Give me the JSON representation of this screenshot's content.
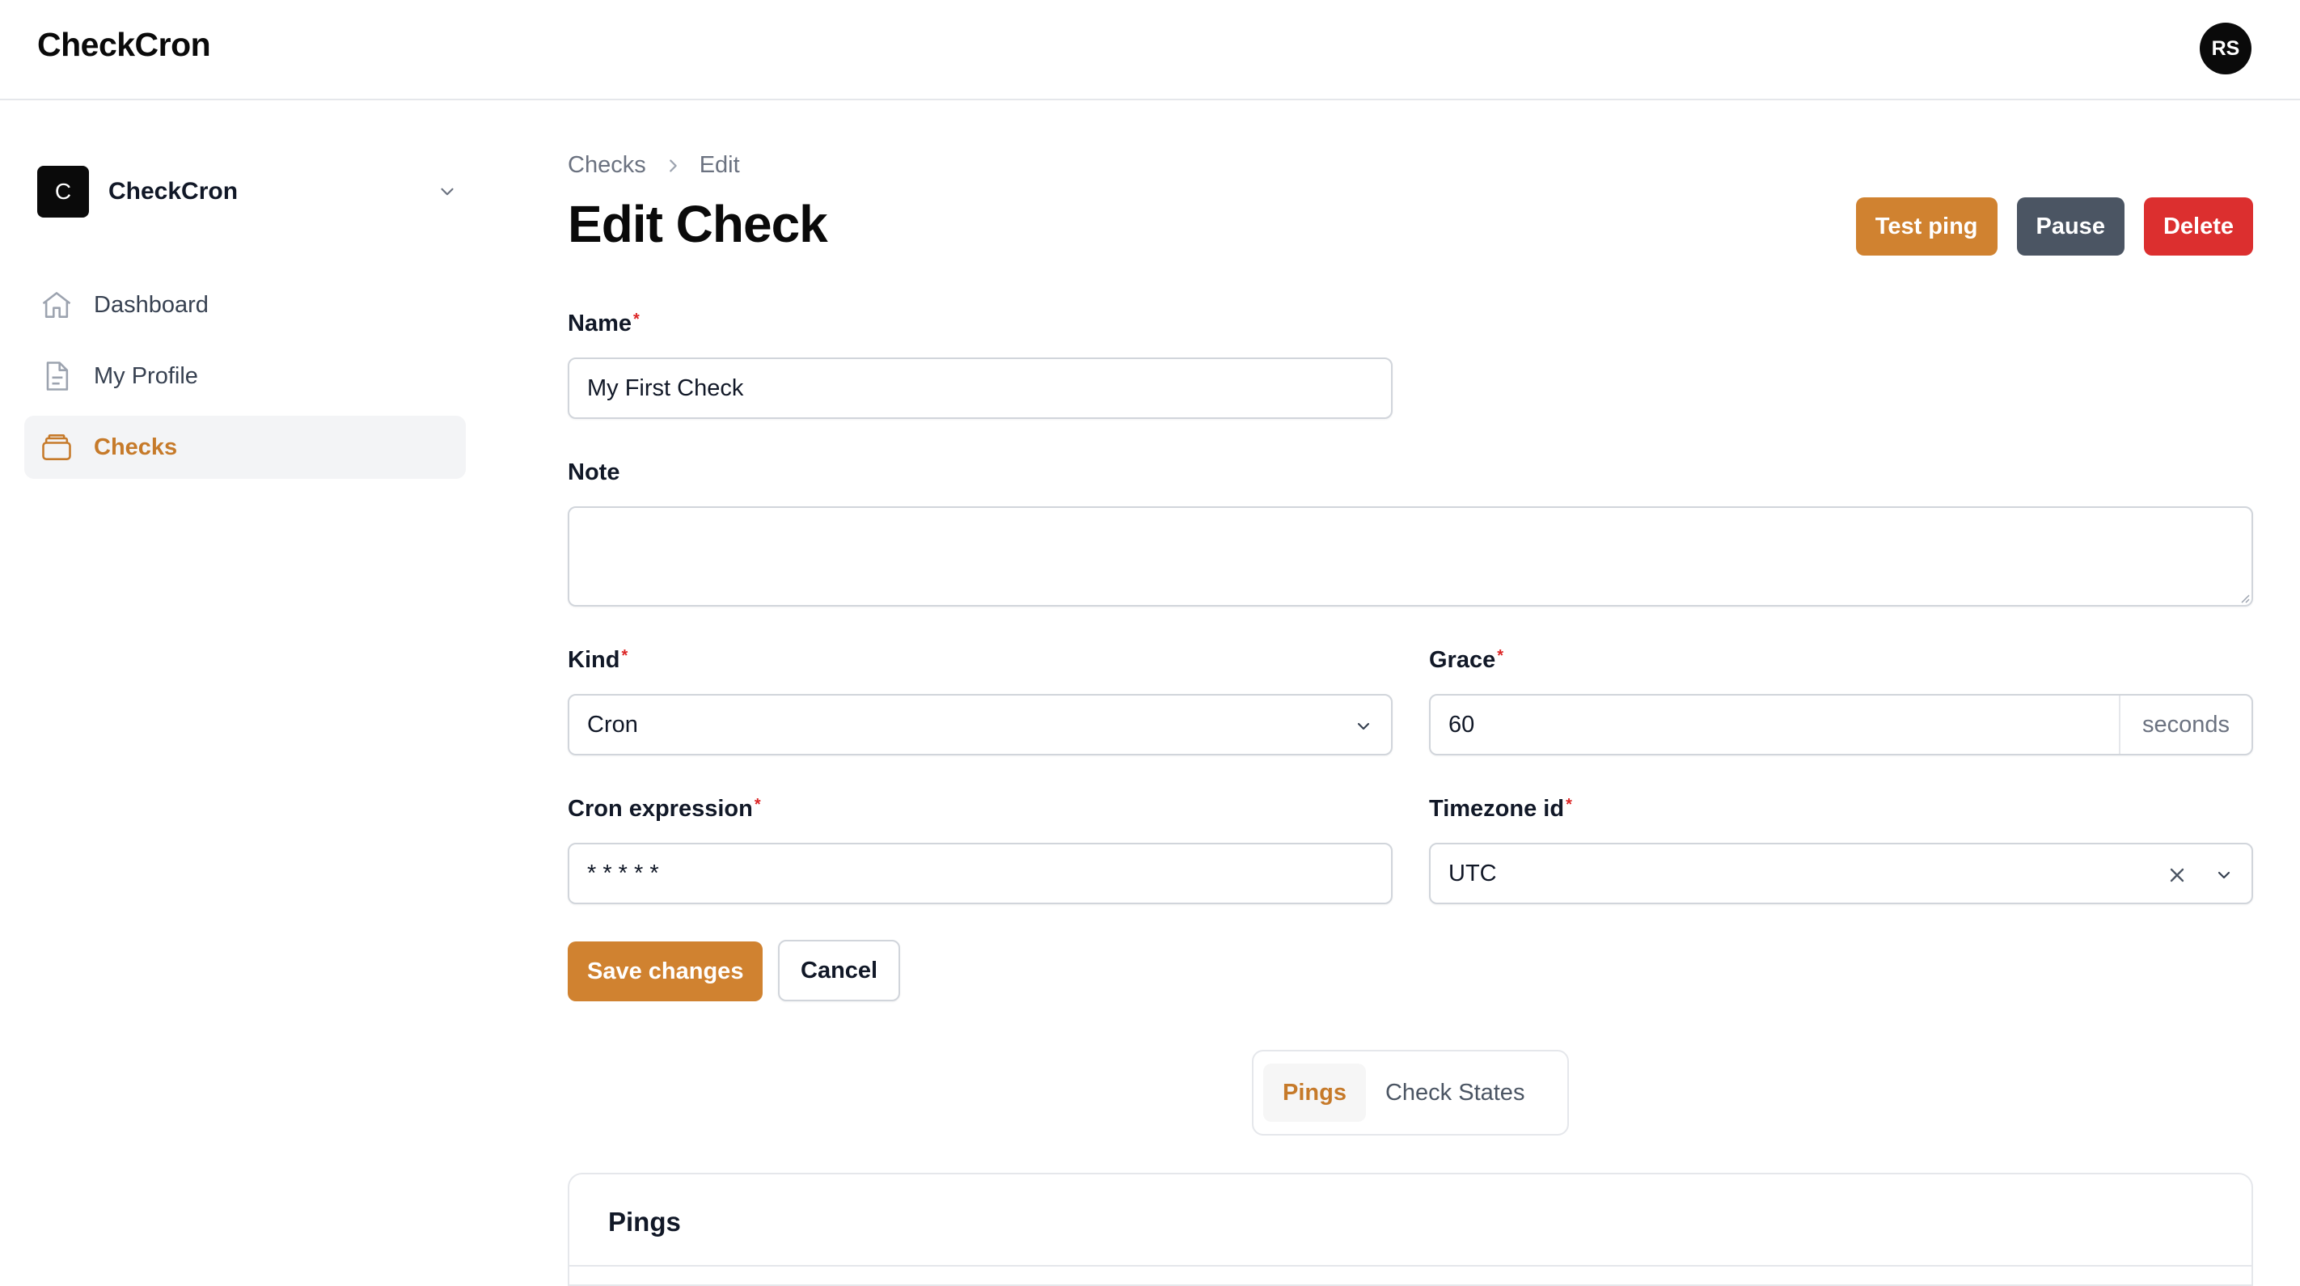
{
  "app": {
    "brand": "CheckCron",
    "user_initials": "RS"
  },
  "sidebar": {
    "team": {
      "initial": "C",
      "name": "CheckCron"
    },
    "items": [
      {
        "label": "Dashboard",
        "icon": "home-icon",
        "active": false
      },
      {
        "label": "My Profile",
        "icon": "document-icon",
        "active": false
      },
      {
        "label": "Checks",
        "icon": "stack-icon",
        "active": true
      }
    ]
  },
  "breadcrumb": {
    "parent": "Checks",
    "current": "Edit"
  },
  "page": {
    "title": "Edit Check"
  },
  "actions": {
    "test_ping": "Test ping",
    "pause": "Pause",
    "delete": "Delete"
  },
  "form": {
    "name": {
      "label": "Name",
      "required": "*",
      "value": "My First Check"
    },
    "note": {
      "label": "Note",
      "value": ""
    },
    "kind": {
      "label": "Kind",
      "required": "*",
      "value": "Cron"
    },
    "grace": {
      "label": "Grace",
      "required": "*",
      "value": "60",
      "suffix": "seconds"
    },
    "cron_expression": {
      "label": "Cron expression",
      "required": "*",
      "value": "* * * * *"
    },
    "timezone": {
      "label": "Timezone id",
      "required": "*",
      "value": "UTC"
    },
    "save_label": "Save changes",
    "cancel_label": "Cancel"
  },
  "tabs": [
    {
      "label": "Pings",
      "active": true
    },
    {
      "label": "Check States",
      "active": false
    }
  ],
  "pings_section": {
    "title": "Pings"
  },
  "colors": {
    "accent": "#d08230",
    "danger": "#dc2f2f",
    "neutral": "#4b5563"
  }
}
